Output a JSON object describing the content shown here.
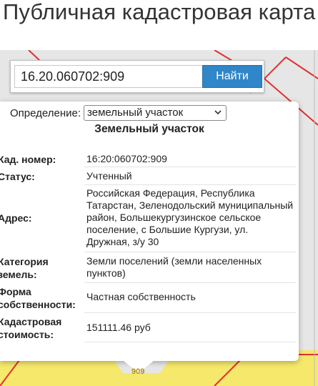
{
  "page": {
    "title": "Публичная кадастровая карта"
  },
  "search": {
    "value": "16.20.060702:909",
    "button_label": "Найти"
  },
  "definition": {
    "label": "Определение:",
    "selected": "земельный участок"
  },
  "popup": {
    "heading": "Земельный участок",
    "rows": [
      {
        "label": "Кад. номер:",
        "value": "16:20:060702:909"
      },
      {
        "label": "Статус:",
        "value": "Учтенный"
      },
      {
        "label": "Адрес:",
        "value": "Российская Федерация, Республика Татарстан, Зеленодольский муниципальный район, Большекургузинское сельское поселение, с Большие Кургузи, ул. Дружная, з/у 30"
      },
      {
        "label": "Категория земель:",
        "value": "Земли поселений (земли населенных пунктов)"
      },
      {
        "label": "Форма собственности:",
        "value": "Частная собственность"
      },
      {
        "label": "Кадастровая стоимость:",
        "value": "151111.46 руб"
      }
    ]
  },
  "map": {
    "parcel_label": "909",
    "colors": {
      "parcel_fill": "#f5e86a",
      "parcel_border": "#e03030",
      "map_bg": "#e6e6e6",
      "accent": "#2f86c9"
    }
  }
}
